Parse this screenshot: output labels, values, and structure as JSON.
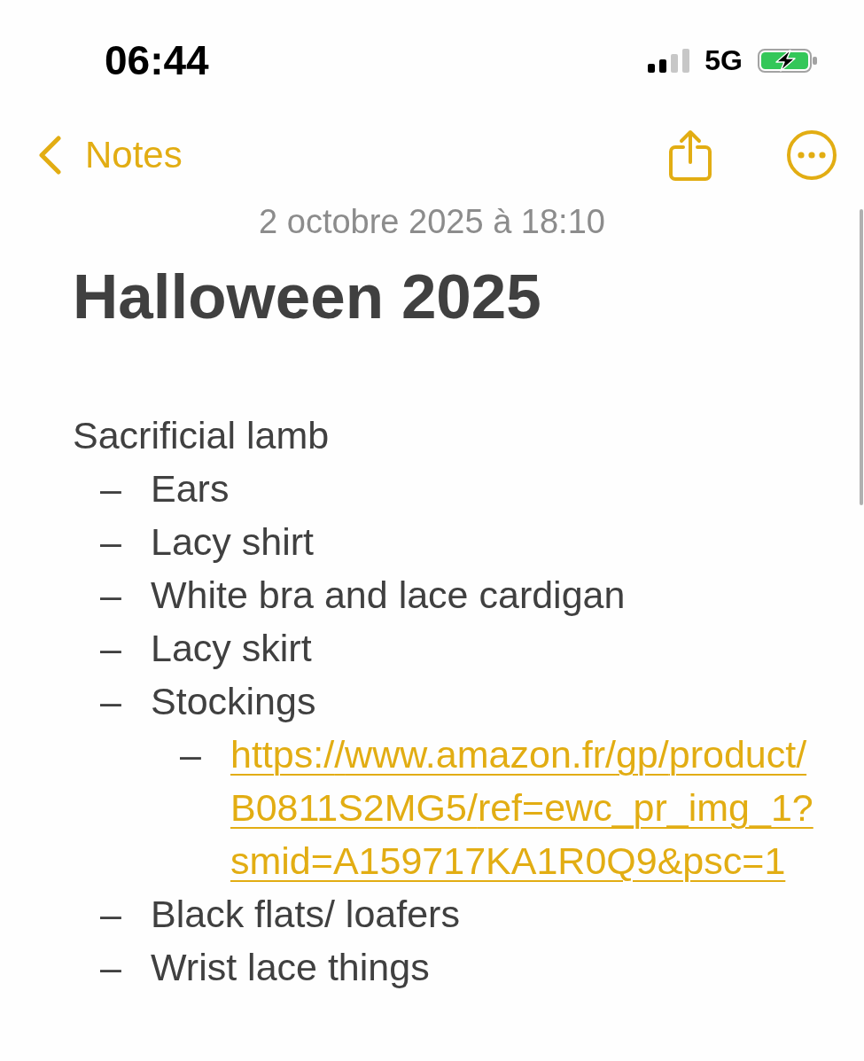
{
  "status_bar": {
    "time": "06:44",
    "network": "5G"
  },
  "toolbar": {
    "back_label": "Notes"
  },
  "note": {
    "date": "2 octobre 2025 à 18:10",
    "title": "Halloween 2025",
    "paragraph": "Sacrificial lamb",
    "items": [
      {
        "kind": "text",
        "bullet": "–",
        "text": "Ears"
      },
      {
        "kind": "text",
        "bullet": "–",
        "text": "Lacy shirt"
      },
      {
        "kind": "text",
        "bullet": "–",
        "text": "White bra and lace cardigan"
      },
      {
        "kind": "text",
        "bullet": "–",
        "text": "Lacy skirt"
      },
      {
        "kind": "text",
        "bullet": "–",
        "text": "Stockings",
        "children": [
          {
            "kind": "link",
            "bullet": "–",
            "text": "https://www.amazon.fr/gp/product/B0811S2MG5/ref=ewc_pr_img_1?smid=A159717KA1R0Q9&psc=1"
          }
        ]
      },
      {
        "kind": "text",
        "bullet": "–",
        "text": "Black flats/ loafers"
      },
      {
        "kind": "text",
        "bullet": "–",
        "text": "Wrist lace things"
      }
    ]
  }
}
